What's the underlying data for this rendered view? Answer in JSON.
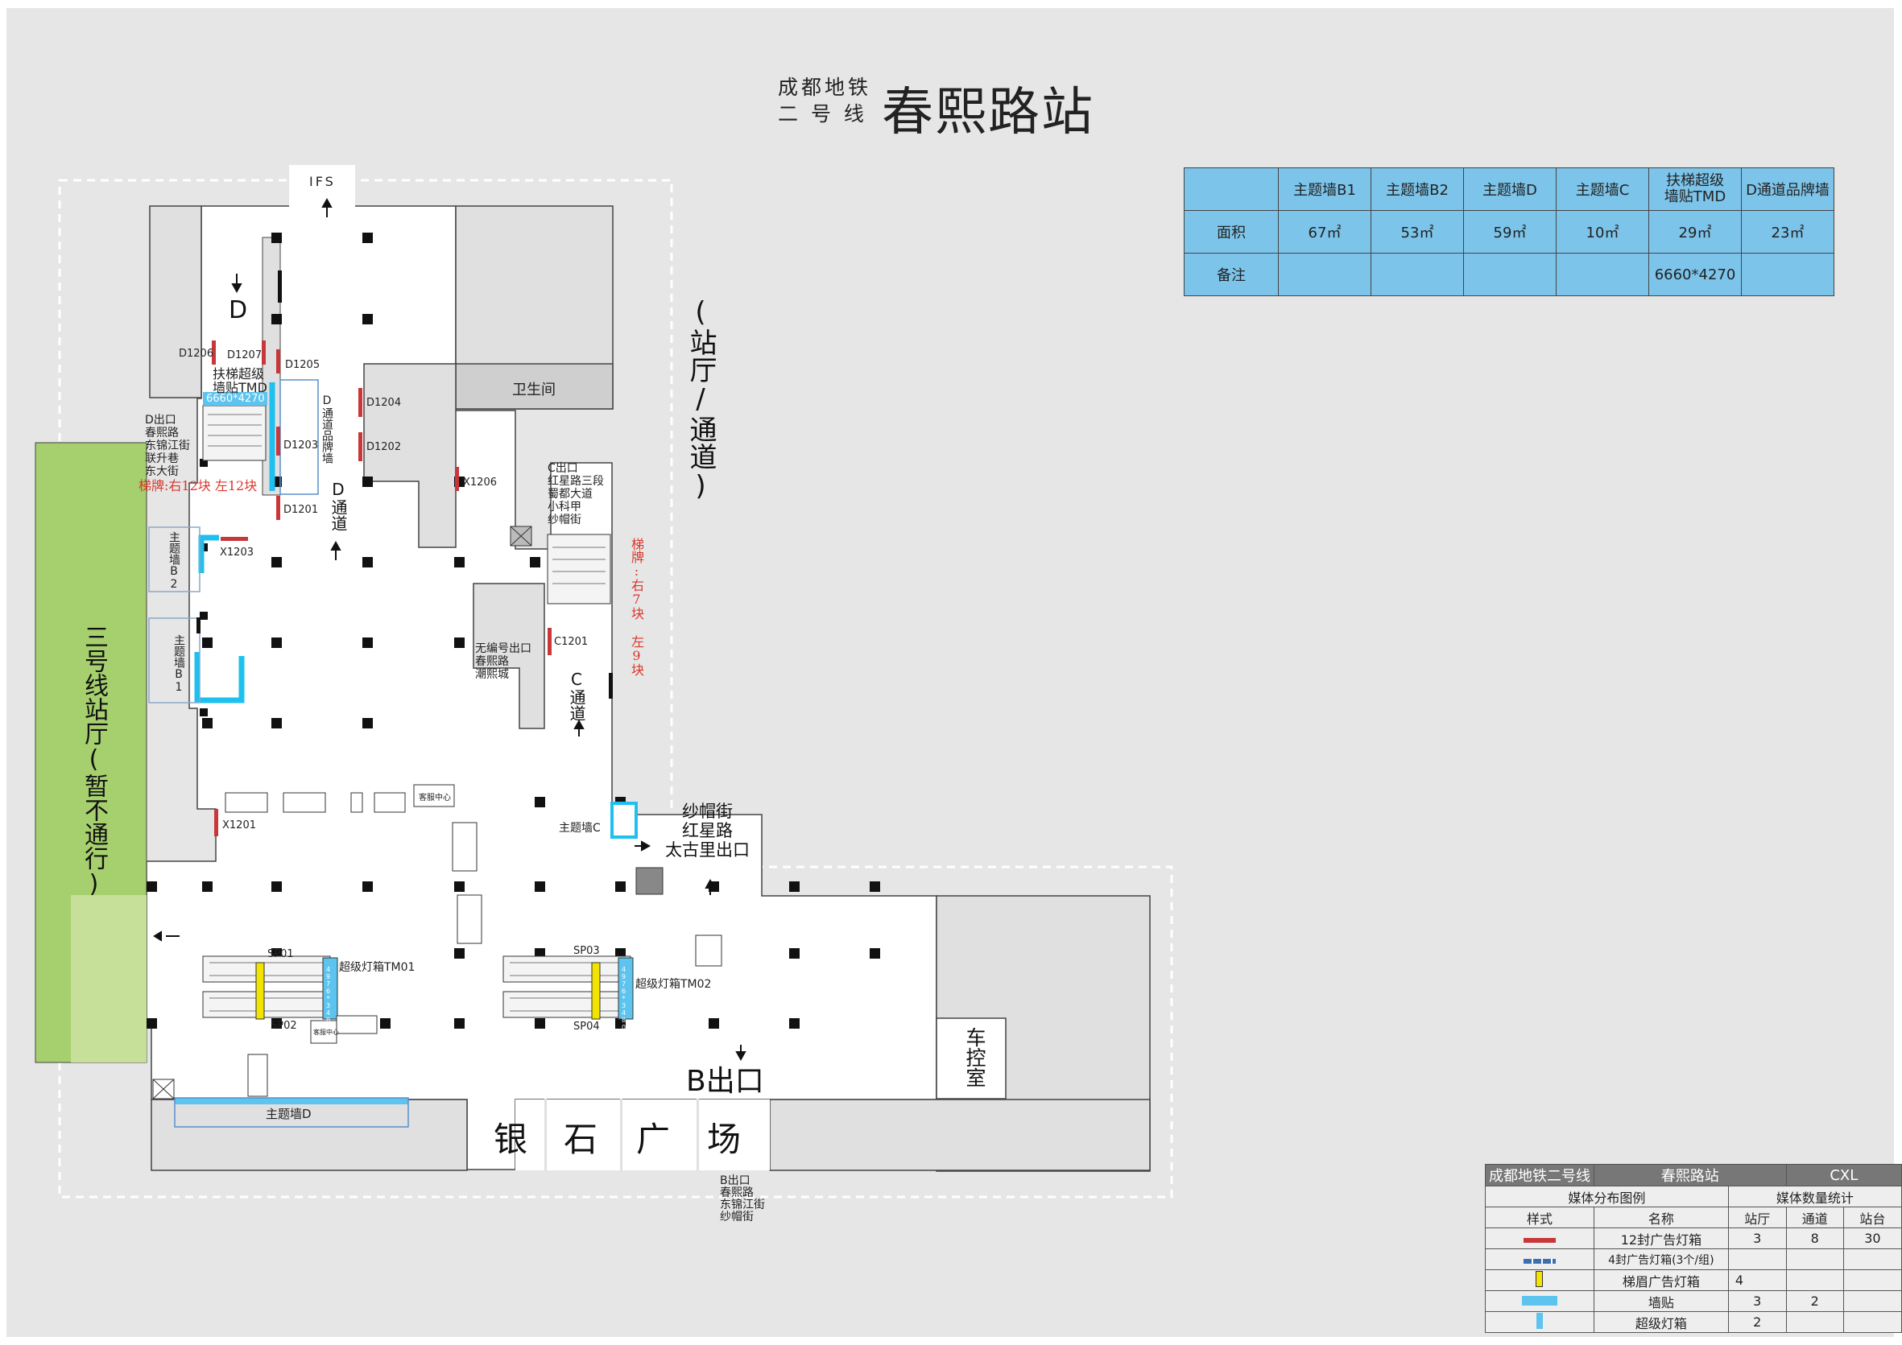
{
  "title": {
    "line": "成都地铁\n二 号 线",
    "line_top": "成都地铁",
    "line_bottom": "二 号 线",
    "station": "春熙路站"
  },
  "area_table": {
    "columns": [
      "主题墙B1",
      "主题墙B2",
      "主题墙D",
      "主题墙C",
      "扶梯超级墙贴TMD",
      "D通道品牌墙"
    ],
    "col_tmd_line1": "扶梯超级",
    "col_tmd_line2": "墙贴TMD",
    "rows": [
      {
        "label": "面积",
        "values": [
          "67㎡",
          "53㎡",
          "59㎡",
          "10㎡",
          "29㎡",
          "23㎡"
        ]
      },
      {
        "label": "备注",
        "values": [
          "",
          "",
          "",
          "",
          "6660*4270",
          ""
        ]
      }
    ]
  },
  "plan": {
    "ifs": "IFS",
    "d_marker": "D",
    "tmd_label_1": "扶梯超级",
    "tmd_label_2": "墙贴TMD",
    "tmd_size": "6660*4270",
    "d_exit": [
      "D出口",
      "春熙路",
      "东锦江街",
      "联升巷",
      "东大街"
    ],
    "d_stairs_note": "梯牌:右12块 左12块",
    "d_brand_wall": "D通道品牌墙",
    "d_channel": "D通道",
    "toilet": "卫生间",
    "c_exit": [
      "C出口",
      "红星路三段",
      "蜀都大道",
      "小科甲",
      "纱帽街"
    ],
    "c_stairs_note": "梯牌:右7块 左9块",
    "c_channel": "C通道",
    "no_number_exit": [
      "无编号出口",
      "春熙路",
      "潮熙城"
    ],
    "hall_label": "(站厅/通道)",
    "line3_hall": "三号线站厅(暂不通行)",
    "theme_b2": "主题墙B2",
    "theme_b1": "主题墙B1",
    "theme_c": "主题墙C",
    "theme_d": "主题墙D",
    "service_center": "客服中心",
    "service_center_small": "客服中心",
    "taigu_exit": [
      "纱帽街",
      "红星路",
      "太古里出口"
    ],
    "super_tm01": "超级灯箱TM01",
    "super_tm02": "超级灯箱TM02",
    "tm01_size": "4976*3480",
    "tm02_size": "4976*3480",
    "b_exit": "B出口",
    "b_exit_list": [
      "B出口",
      "春熙路",
      "东锦江街",
      "纱帽街"
    ],
    "control_room": "车控室",
    "plaza": [
      "银",
      "石",
      "广",
      "场"
    ],
    "codes": {
      "d1206": "D1206",
      "d1207": "D1207",
      "d1205": "D1205",
      "d1204": "D1204",
      "d1202": "D1202",
      "d1203": "D1203",
      "d1201": "D1201",
      "x1206": "X1206",
      "x1203": "X1203",
      "c1201": "C1201",
      "x1201": "X1201",
      "sp01": "SP01",
      "sp02": "SP02",
      "sp03": "SP03",
      "sp04": "SP04"
    }
  },
  "legend": {
    "header": [
      "成都地铁二号线",
      "春熙路站",
      "CXL"
    ],
    "subheader": [
      "媒体分布图例",
      "媒体数量统计"
    ],
    "columns": [
      "样式",
      "名称",
      "站厅",
      "通道",
      "站台"
    ],
    "rows": [
      {
        "name": "12封广告灯箱",
        "hall": "3",
        "channel": "8",
        "platform": "30",
        "swatch": "#c8373a"
      },
      {
        "name": "4封广告灯箱(3个/组)",
        "hall": "",
        "channel": "",
        "platform": "",
        "swatch": "#3a6fb0"
      },
      {
        "name": "梯眉广告灯箱",
        "hall": "4",
        "channel": "",
        "platform": "",
        "swatch": "#f2e400"
      },
      {
        "name": "墙贴",
        "hall": "3",
        "channel": "2",
        "platform": "",
        "swatch": "#5cc4ee"
      },
      {
        "name": "超级灯箱",
        "hall": "2",
        "channel": "",
        "platform": "",
        "swatch": "#5cc4ee"
      }
    ]
  },
  "colors": {
    "background": "#e6e6e6",
    "table_fill": "#7cc4ea",
    "line3_green": "#a6cf6e",
    "wall_blue": "#1ec0f0",
    "ad_red": "#c8373a",
    "yellow": "#f2e400"
  }
}
